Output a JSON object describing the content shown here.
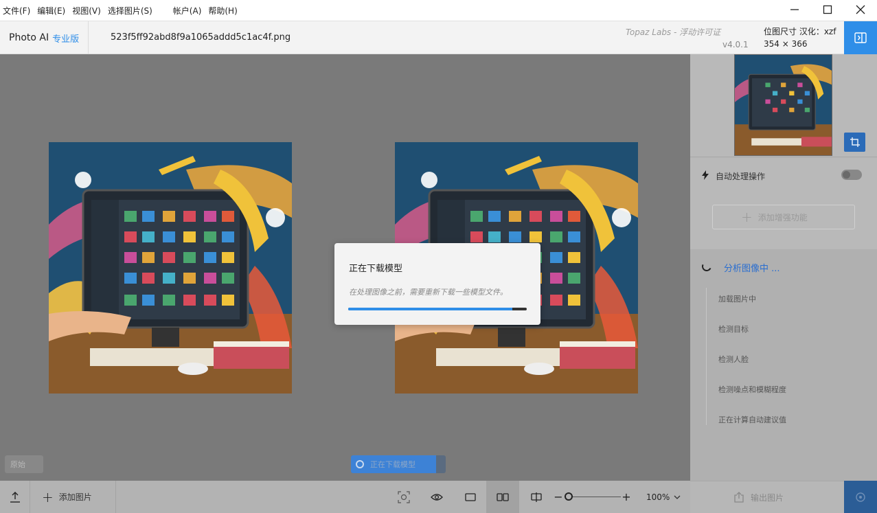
{
  "menu": {
    "items": [
      "文件(F)",
      "编辑(E)",
      "视图(V)",
      "选择图片(S)",
      "帐户(A)",
      "帮助(H)"
    ]
  },
  "header": {
    "brand_name": "Photo AI",
    "brand_edition": "专业版",
    "filename": "523f5ff92abd8f9a1065addd5c1ac4f.png",
    "company": "Topaz Labs - 浮动许可证",
    "version": "v4.0.1",
    "dim_label": "位图尺寸 汉化：xzf",
    "dim_value": "354 × 366"
  },
  "canvas": {
    "original_label": "原始",
    "download_pill_label": "正在下载模型",
    "download_pill_progress": 0.9
  },
  "modal": {
    "title": "正在下载模型",
    "description": "在处理图像之前，需要重新下载一些模型文件。",
    "progress": 0.92
  },
  "right_panel": {
    "auto_label": "自动处理操作",
    "auto_enabled": false,
    "add_enhancement": "添加增强功能",
    "analysis_title": "分析图像中 ...",
    "steps": [
      "加载图片中",
      "检测目标",
      "检测人脸",
      "检测噪点和模糊程度",
      "正在计算自动建议值"
    ],
    "export_label": "输出图片"
  },
  "bottombar": {
    "add_image": "添加图片",
    "zoom": "100%",
    "zoom_fraction": 0.0
  },
  "colors": {
    "accent": "#2f8ee8",
    "canvas_bg": "#7a7a7a"
  }
}
